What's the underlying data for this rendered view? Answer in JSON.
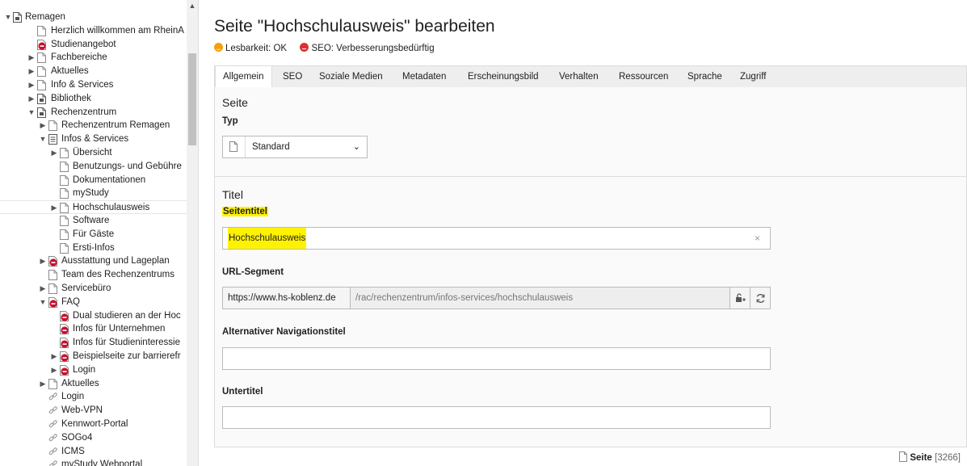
{
  "tree": {
    "items": [
      {
        "label": "Remagen",
        "level": 0,
        "toggle": "open",
        "icon": "page-root-icon"
      },
      {
        "label": "Herzlich willkommen am RheinA",
        "level": 1,
        "toggle": "",
        "icon": "page-icon"
      },
      {
        "label": "Studienangebot",
        "level": 1,
        "toggle": "",
        "icon": "page-restricted-icon"
      },
      {
        "label": "Fachbereiche",
        "level": 1,
        "toggle": "closed",
        "icon": "page-icon"
      },
      {
        "label": "Aktuelles",
        "level": 1,
        "toggle": "closed",
        "icon": "page-icon"
      },
      {
        "label": "Info & Services",
        "level": 1,
        "toggle": "closed",
        "icon": "page-icon"
      },
      {
        "label": "Bibliothek",
        "level": 1,
        "toggle": "closed",
        "icon": "page-root-icon"
      },
      {
        "label": "Rechenzentrum",
        "level": 1,
        "toggle": "open",
        "icon": "page-root-icon"
      },
      {
        "label": "Rechenzentrum Remagen",
        "level": 2,
        "toggle": "closed",
        "icon": "page-icon"
      },
      {
        "label": "Infos & Services",
        "level": 2,
        "toggle": "open",
        "icon": "page-list-icon"
      },
      {
        "label": "Übersicht",
        "level": 3,
        "toggle": "closed",
        "icon": "page-icon"
      },
      {
        "label": "Benutzungs- und Gebühre",
        "level": 3,
        "toggle": "",
        "icon": "page-icon"
      },
      {
        "label": "Dokumentationen",
        "level": 3,
        "toggle": "",
        "icon": "page-icon"
      },
      {
        "label": "myStudy",
        "level": 3,
        "toggle": "",
        "icon": "page-icon"
      },
      {
        "label": "Hochschulausweis",
        "level": 3,
        "toggle": "closed",
        "icon": "page-icon",
        "selected": true
      },
      {
        "label": "Software",
        "level": 3,
        "toggle": "",
        "icon": "page-icon"
      },
      {
        "label": "Für Gäste",
        "level": 3,
        "toggle": "",
        "icon": "page-icon"
      },
      {
        "label": "Ersti-Infos",
        "level": 3,
        "toggle": "",
        "icon": "page-icon"
      },
      {
        "label": "Ausstattung und Lageplan",
        "level": 2,
        "toggle": "closed",
        "icon": "page-restricted-icon"
      },
      {
        "label": "Team des Rechenzentrums",
        "level": 2,
        "toggle": "",
        "icon": "page-icon"
      },
      {
        "label": "Servicebüro",
        "level": 2,
        "toggle": "closed",
        "icon": "page-icon"
      },
      {
        "label": "FAQ",
        "level": 2,
        "toggle": "open",
        "icon": "page-restricted-icon"
      },
      {
        "label": "Dual studieren an der Hoc",
        "level": 3,
        "toggle": "",
        "icon": "page-restricted-icon"
      },
      {
        "label": "Infos für Unternehmen",
        "level": 3,
        "toggle": "",
        "icon": "page-restricted-icon"
      },
      {
        "label": "Infos für Studieninteressie",
        "level": 3,
        "toggle": "",
        "icon": "page-restricted-icon"
      },
      {
        "label": "Beispielseite zur barrierefr",
        "level": 3,
        "toggle": "closed",
        "icon": "page-restricted-icon"
      },
      {
        "label": "Login",
        "level": 3,
        "toggle": "closed",
        "icon": "page-restricted-icon"
      },
      {
        "label": "Aktuelles",
        "level": 2,
        "toggle": "closed",
        "icon": "page-icon"
      },
      {
        "label": "Login",
        "level": 2,
        "toggle": "",
        "icon": "link-icon"
      },
      {
        "label": "Web-VPN",
        "level": 2,
        "toggle": "",
        "icon": "link-icon"
      },
      {
        "label": "Kennwort-Portal",
        "level": 2,
        "toggle": "",
        "icon": "link-icon"
      },
      {
        "label": "SOGo4",
        "level": 2,
        "toggle": "",
        "icon": "link-icon"
      },
      {
        "label": "ICMS",
        "level": 2,
        "toggle": "",
        "icon": "link-icon"
      },
      {
        "label": "myStudy Webportal",
        "level": 2,
        "toggle": "",
        "icon": "link-icon"
      }
    ]
  },
  "header": {
    "title": "Seite \"Hochschulausweis\" bearbeiten",
    "readability": "Lesbarkeit: OK",
    "seo": "SEO: Verbesserungsbedürftig"
  },
  "tabs": [
    "Allgemein",
    "SEO",
    "Soziale Medien",
    "Metadaten",
    "Erscheinungsbild",
    "Verhalten",
    "Ressourcen",
    "Sprache",
    "Zugriff"
  ],
  "form": {
    "section_page": "Seite",
    "typ_label": "Typ",
    "typ_value": "Standard",
    "section_title": "Titel",
    "seitentitel_label": "Seitentitel",
    "seitentitel_value": "Hochschulausweis",
    "url_label": "URL-Segment",
    "url_prefix": "https://www.hs-koblenz.de",
    "url_value": "/rac/rechenzentrum/infos-services/hochschulausweis",
    "altnav_label": "Alternativer Navigationstitel",
    "altnav_value": "",
    "untertitel_label": "Untertitel",
    "untertitel_value": ""
  },
  "footer": {
    "record_type": "Seite",
    "record_id": "[3266]"
  },
  "colors": {
    "highlight": "#fff200",
    "restricted": "#c8102e",
    "status_ok": "#f59e0b",
    "status_bad": "#e02f2f"
  }
}
